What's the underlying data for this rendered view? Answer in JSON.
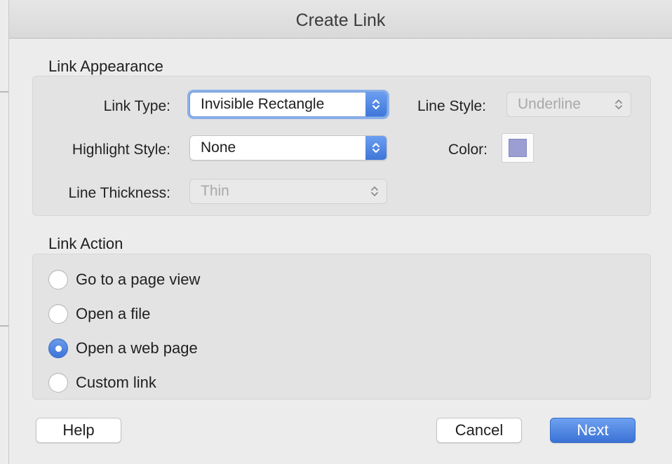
{
  "dialog": {
    "title": "Create Link"
  },
  "appearance": {
    "section_label": "Link Appearance",
    "link_type": {
      "label": "Link Type:",
      "value": "Invisible Rectangle"
    },
    "line_style": {
      "label": "Line Style:",
      "value": "Underline"
    },
    "highlight_style": {
      "label": "Highlight Style:",
      "value": "None"
    },
    "color": {
      "label": "Color:",
      "swatch": "#9a9ed3"
    },
    "line_thickness": {
      "label": "Line Thickness:",
      "value": "Thin"
    }
  },
  "action": {
    "section_label": "Link Action",
    "options": [
      {
        "label": "Go to a page view",
        "selected": false
      },
      {
        "label": "Open a file",
        "selected": false
      },
      {
        "label": "Open a web page",
        "selected": true
      },
      {
        "label": "Custom link",
        "selected": false
      }
    ]
  },
  "buttons": {
    "help": "Help",
    "cancel": "Cancel",
    "next": "Next"
  },
  "icons": {
    "stepper": "chevron-up-down-icon",
    "radio_selected": "radio-dot-icon"
  },
  "colors": {
    "accent": "#4a7fe0",
    "panel": "#e3e3e3",
    "window": "#ececec"
  }
}
